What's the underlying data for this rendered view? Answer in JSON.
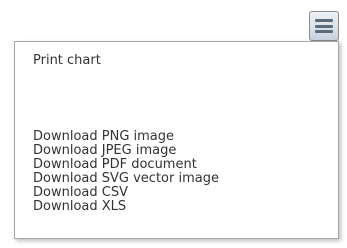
{
  "menu": {
    "button_icon": "hamburger-icon",
    "items": [
      {
        "label": "Print chart"
      },
      {
        "label": "Download PNG image"
      },
      {
        "label": "Download JPEG image"
      },
      {
        "label": "Download PDF document"
      },
      {
        "label": "Download SVG vector image"
      },
      {
        "label": "Download CSV"
      },
      {
        "label": "Download XLS"
      }
    ]
  }
}
